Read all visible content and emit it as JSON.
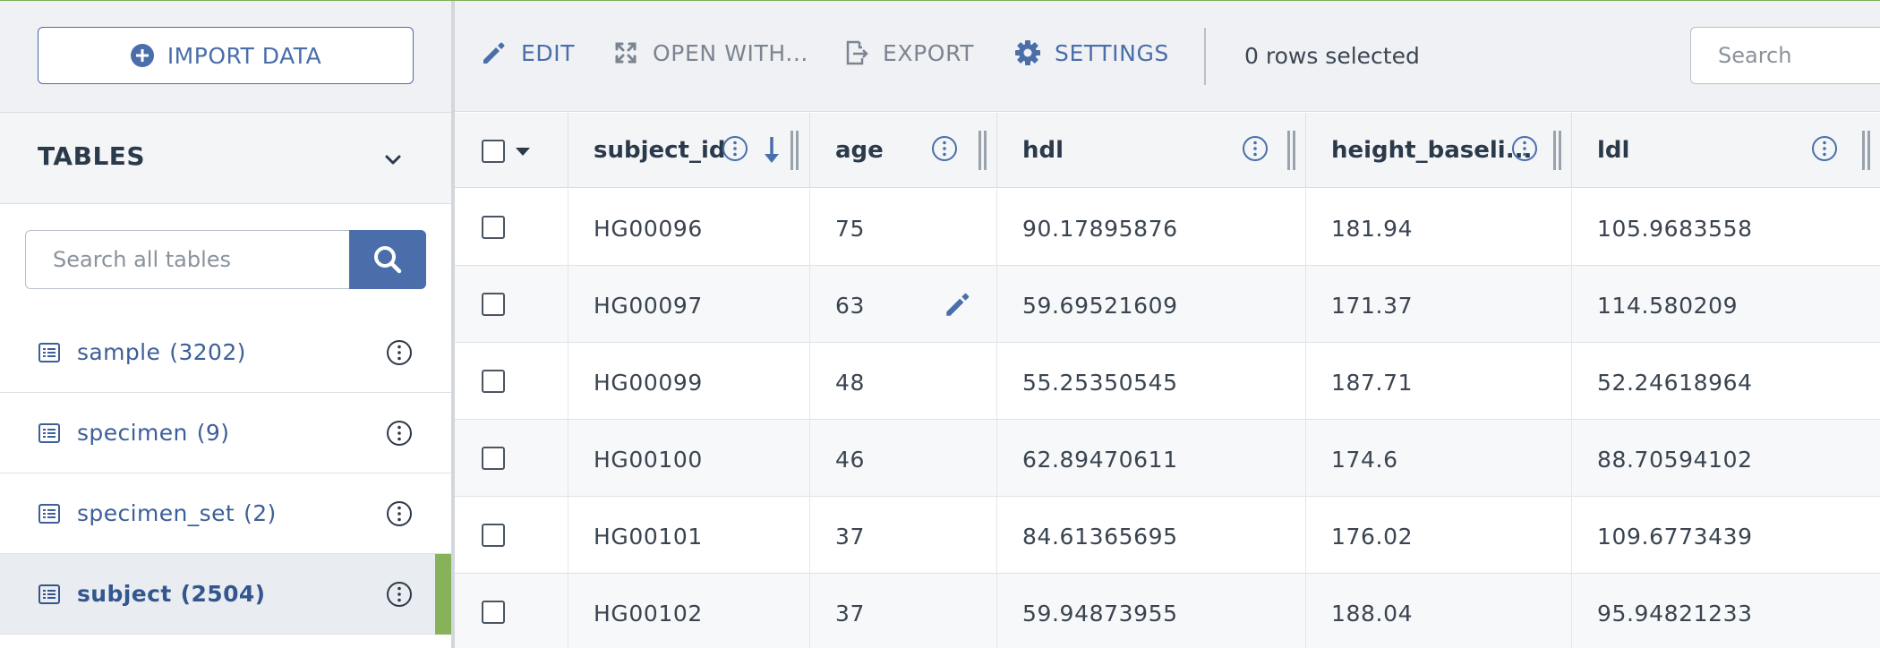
{
  "sidebar": {
    "import_label": "IMPORT DATA",
    "tables_title": "TABLES",
    "search_placeholder": "Search all tables",
    "tables": [
      {
        "name": "sample",
        "count": "(3202)"
      },
      {
        "name": "specimen",
        "count": "(9)"
      },
      {
        "name": "specimen_set",
        "count": "(2)"
      },
      {
        "name": "subject",
        "count": "(2504)",
        "active": true
      }
    ]
  },
  "toolbar": {
    "edit": "EDIT",
    "open_with": "OPEN WITH...",
    "export": "EXPORT",
    "settings": "SETTINGS",
    "rows_selected": "0 rows selected",
    "search_placeholder": "Search"
  },
  "grid": {
    "columns": [
      "subject_id",
      "age",
      "hdl",
      "height_baseli...",
      "ldl"
    ],
    "sorted_column": "subject_id",
    "rows": [
      [
        "HG00096",
        "75",
        "90.17895876",
        "181.94",
        "105.9683558"
      ],
      [
        "HG00097",
        "63",
        "59.69521609",
        "171.37",
        "114.580209"
      ],
      [
        "HG00099",
        "48",
        "55.25350545",
        "187.71",
        "52.24618964"
      ],
      [
        "HG00100",
        "46",
        "62.89470611",
        "174.6",
        "88.70594102"
      ],
      [
        "HG00101",
        "37",
        "84.61365695",
        "176.02",
        "109.6773439"
      ],
      [
        "HG00102",
        "37",
        "59.94873955",
        "188.04",
        "95.94821233"
      ]
    ]
  },
  "colors": {
    "accent": "#4a6ea9",
    "active_indicator": "#86b35a",
    "muted": "#7b8591"
  },
  "icons": [
    "plus-circle-icon",
    "chevron-down-icon",
    "search-icon",
    "list-icon",
    "info-icon",
    "pencil-icon",
    "expand-icon",
    "export-icon",
    "gear-icon",
    "sort-down-icon",
    "caret-down-icon"
  ]
}
